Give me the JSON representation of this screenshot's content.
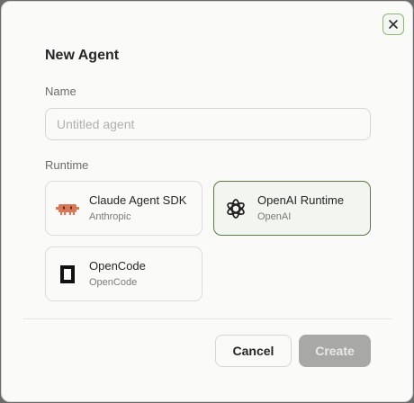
{
  "dialog": {
    "title": "New Agent",
    "close_icon": "close-icon"
  },
  "name_field": {
    "label": "Name",
    "placeholder": "Untitled agent",
    "value": ""
  },
  "runtime": {
    "label": "Runtime",
    "options": [
      {
        "name": "Claude Agent SDK",
        "provider": "Anthropic",
        "icon": "claude-icon",
        "icon_color": "#d97757",
        "selected": false
      },
      {
        "name": "OpenAI Runtime",
        "provider": "OpenAI",
        "icon": "openai-icon",
        "icon_color": "#1f1f1f",
        "selected": true
      },
      {
        "name": "OpenCode",
        "provider": "OpenCode",
        "icon": "opencode-icon",
        "icon_color": "#111111",
        "selected": false
      }
    ]
  },
  "footer": {
    "cancel_label": "Cancel",
    "create_label": "Create",
    "create_disabled": true
  },
  "colors": {
    "selected_border": "#5d7a45",
    "close_border": "#8fb873"
  }
}
